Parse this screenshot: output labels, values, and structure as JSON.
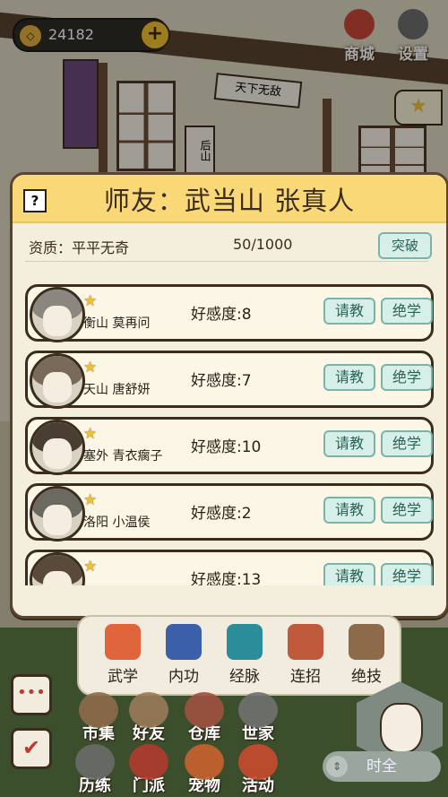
{
  "hud": {
    "coins": "24182",
    "plus": "+",
    "shop_label": "商城",
    "settings_label": "设置"
  },
  "bg": {
    "sign_text": "天下无敌",
    "sign2_text": "后山"
  },
  "modal": {
    "help": "?",
    "title": "师友：武当山  张真人",
    "quality_label": "资质：平平无奇",
    "progress": "50/1000",
    "break_label": "突破"
  },
  "friends": [
    {
      "name": "衡山  莫再问",
      "affinity": "好感度:8",
      "ask": "请教",
      "skill": "绝学"
    },
    {
      "name": "天山  唐舒妍",
      "affinity": "好感度:7",
      "ask": "请教",
      "skill": "绝学"
    },
    {
      "name": "塞外  青衣瘸子",
      "affinity": "好感度:10",
      "ask": "请教",
      "skill": "绝学"
    },
    {
      "name": "洛阳  小温侯",
      "affinity": "好感度:2",
      "ask": "请教",
      "skill": "绝学"
    },
    {
      "name": "",
      "affinity": "好感度:13",
      "ask": "请教",
      "skill": "绝学"
    }
  ],
  "skills": [
    "武学",
    "内功",
    "经脉",
    "连招",
    "绝技"
  ],
  "bottom_menu": [
    "市集",
    "好友",
    "仓库",
    "世家",
    "历练",
    "门派",
    "宠物",
    "活动"
  ],
  "time_label": "时全",
  "colors": {
    "modal_bg": "#f4efdd",
    "header": "#f8d877",
    "button_bg": "#d6efe8",
    "button_text": "#2a6258",
    "star": "#f0c030"
  }
}
